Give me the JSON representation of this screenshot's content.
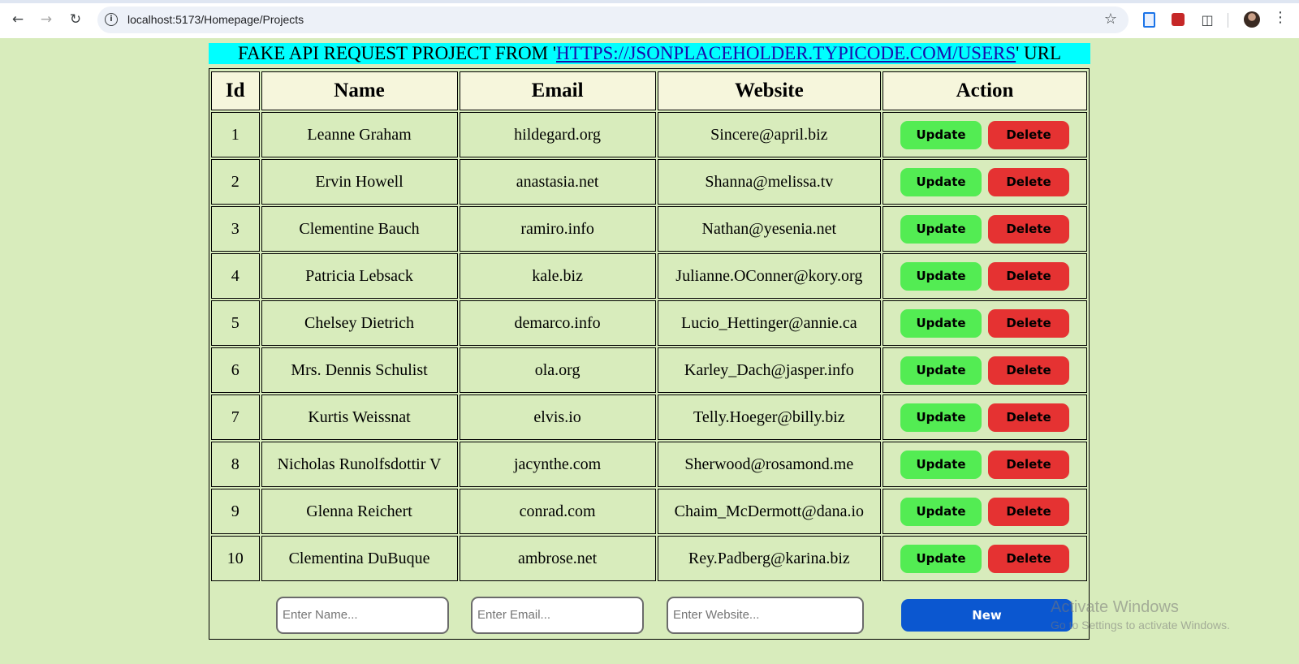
{
  "browser": {
    "url": "localhost:5173/Homepage/Projects",
    "icons": {
      "back": "back-arrow-icon",
      "forward": "forward-arrow-icon",
      "reload": "reload-icon",
      "site_info": "info-icon",
      "bookmark": "star-icon",
      "extensions": "puzzle-icon",
      "menu": "kebab-menu-icon"
    }
  },
  "banner": {
    "prefix": "FAKE API REQUEST PROJECT FROM '",
    "link": "HTTPS://JSONPLACEHOLDER.TYPICODE.COM/USERS",
    "suffix": "' URL"
  },
  "table": {
    "headers": [
      "Id",
      "Name",
      "Email",
      "Website",
      "Action"
    ],
    "rows": [
      {
        "id": "1",
        "name": "Leanne Graham",
        "email": "hildegard.org",
        "website": "Sincere@april.biz"
      },
      {
        "id": "2",
        "name": "Ervin Howell",
        "email": "anastasia.net",
        "website": "Shanna@melissa.tv"
      },
      {
        "id": "3",
        "name": "Clementine Bauch",
        "email": "ramiro.info",
        "website": "Nathan@yesenia.net"
      },
      {
        "id": "4",
        "name": "Patricia Lebsack",
        "email": "kale.biz",
        "website": "Julianne.OConner@kory.org"
      },
      {
        "id": "5",
        "name": "Chelsey Dietrich",
        "email": "demarco.info",
        "website": "Lucio_Hettinger@annie.ca"
      },
      {
        "id": "6",
        "name": "Mrs. Dennis Schulist",
        "email": "ola.org",
        "website": "Karley_Dach@jasper.info"
      },
      {
        "id": "7",
        "name": "Kurtis Weissnat",
        "email": "elvis.io",
        "website": "Telly.Hoeger@billy.biz"
      },
      {
        "id": "8",
        "name": "Nicholas Runolfsdottir V",
        "email": "jacynthe.com",
        "website": "Sherwood@rosamond.me"
      },
      {
        "id": "9",
        "name": "Glenna Reichert",
        "email": "conrad.com",
        "website": "Chaim_McDermott@dana.io"
      },
      {
        "id": "10",
        "name": "Clementina DuBuque",
        "email": "ambrose.net",
        "website": "Rey.Padberg@karina.biz"
      }
    ],
    "update_label": "Update",
    "delete_label": "Delete"
  },
  "form": {
    "name_placeholder": "Enter Name...",
    "email_placeholder": "Enter Email...",
    "website_placeholder": "Enter Website...",
    "new_label": "New"
  },
  "watermark": {
    "line1": "Activate Windows",
    "line2": "Go to Settings to activate Windows."
  },
  "colors": {
    "page_background": "#d8ecbc",
    "banner_background": "#00ffff",
    "header_background": "#f6f6dc",
    "update_button": "#53ec53",
    "delete_button": "#e53232",
    "new_button": "#0b57d0"
  }
}
